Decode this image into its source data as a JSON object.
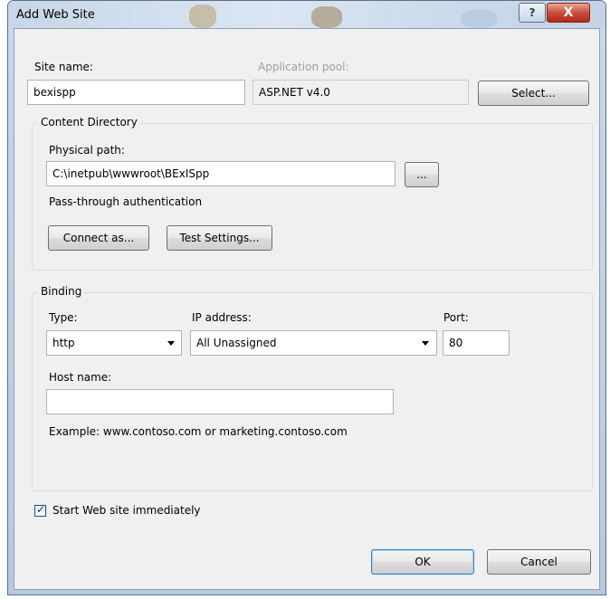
{
  "window": {
    "title": "Add Web Site",
    "help_label": "?",
    "close_label": "X"
  },
  "site_name": {
    "label": "Site name:",
    "value": "bexispp"
  },
  "app_pool": {
    "label": "Application pool:",
    "value": "ASP.NET v4.0",
    "select_label": "Select..."
  },
  "content_directory": {
    "title": "Content Directory",
    "physical_path_label": "Physical path:",
    "physical_path_value": "C:\\inetpub\\wwwroot\\BExISpp",
    "browse_label": "...",
    "auth_text": "Pass-through authentication",
    "connect_as_label": "Connect as...",
    "test_settings_label": "Test Settings..."
  },
  "binding": {
    "title": "Binding",
    "type_label": "Type:",
    "type_value": "http",
    "ip_label": "IP address:",
    "ip_value": "All Unassigned",
    "port_label": "Port:",
    "port_value": "80",
    "host_label": "Host name:",
    "host_value": "",
    "example_text": "Example: www.contoso.com or marketing.contoso.com"
  },
  "start_immediately": {
    "label": "Start Web site immediately",
    "checked": true
  },
  "footer": {
    "ok_label": "OK",
    "cancel_label": "Cancel"
  }
}
